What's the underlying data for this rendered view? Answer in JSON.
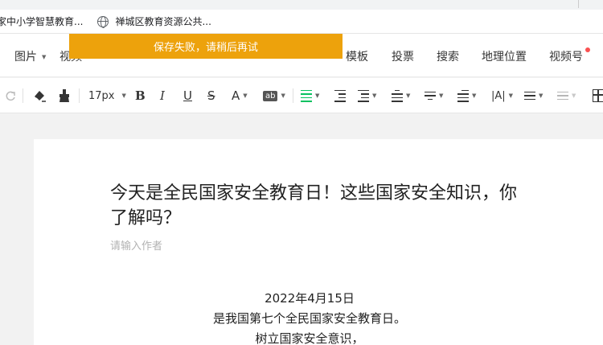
{
  "browser": {
    "bookmarks": [
      {
        "label": "家中小学智慧教育..."
      },
      {
        "label": "禅城区教育资源公共..."
      }
    ]
  },
  "insert_bar": {
    "items": [
      {
        "label": "图片",
        "has_dropdown": true
      },
      {
        "label": "视频",
        "has_dropdown": false
      },
      {
        "label": "模板"
      },
      {
        "label": "投票"
      },
      {
        "label": "搜索"
      },
      {
        "label": "地理位置"
      },
      {
        "label": "视频号",
        "badge_color": "#fa5151"
      }
    ]
  },
  "toast": {
    "message": "保存失败，请稍后再试",
    "color": "#eda20c"
  },
  "format_bar": {
    "font_size": "17px",
    "bold": "B",
    "italic": "I",
    "underline": "U",
    "strike": "S",
    "font_color": "A",
    "bg_color": "ab",
    "letter_spacing": "|A|",
    "accent_color": "#07c160"
  },
  "article": {
    "title": "今天是全民国家安全教育日！这些国家安全知识，你了解吗？",
    "author_placeholder": "请输入作者",
    "lines": [
      "2022年4月15日",
      "是我国第七个全民国家安全教育日。",
      "树立国家安全意识，"
    ]
  }
}
